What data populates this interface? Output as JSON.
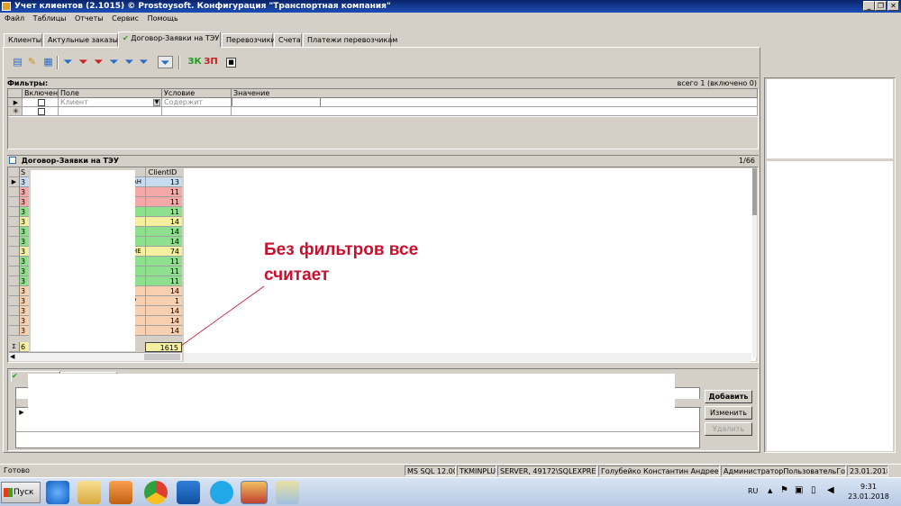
{
  "window": {
    "title": "Учет клиентов (2.1015) © Prostoysoft. Конфигурация \"Транспортная компания\"",
    "minimize": "_",
    "restore": "❐",
    "close": "✕"
  },
  "menu": [
    "Файл",
    "Таблицы",
    "Отчеты",
    "Сервис",
    "Помощь"
  ],
  "tabs": [
    "Клиенты",
    "Актульные заказы",
    "Договор-Заявки на ТЭУ",
    "Перевозчики",
    "Счета",
    "Платежи перевозчикам"
  ],
  "active_tab_check": "✔",
  "toolbar": {
    "zk_label": "ЗК",
    "zp_label": "ЗП"
  },
  "filters": {
    "title": "Фильтры:",
    "summary": "всего 1 (включено 0)",
    "columns": [
      "Включен",
      "Поле",
      "Условие",
      "Значение"
    ],
    "row": {
      "field": "Клиент",
      "condition": "Содержит",
      "value": ""
    },
    "new_row_marker": "✳"
  },
  "grid": {
    "title": "Договор-Заявки на ТЭУ",
    "counter": "1/66",
    "col_first": "S",
    "col_client": "ClientID",
    "rows": [
      {
        "c1": "3",
        "c2": "АН",
        "client": "13",
        "color": "#c8dcf0"
      },
      {
        "c1": "3",
        "c2": "",
        "client": "11",
        "color": "#f4a8a8"
      },
      {
        "c1": "3",
        "c2": "",
        "client": "11",
        "color": "#f4a8a8"
      },
      {
        "c1": "3",
        "c2": "",
        "client": "11",
        "color": "#8ee08e"
      },
      {
        "c1": "3",
        "c2": "",
        "client": "14",
        "color": "#f4f0a0"
      },
      {
        "c1": "3",
        "c2": "",
        "client": "14",
        "color": "#8ee08e"
      },
      {
        "c1": "3",
        "c2": "",
        "client": "14",
        "color": "#8ee08e"
      },
      {
        "c1": "3",
        "c2": "НЕ",
        "client": "74",
        "color": "#f4f0a0"
      },
      {
        "c1": "3",
        "c2": "",
        "client": "11",
        "color": "#8ee08e"
      },
      {
        "c1": "3",
        "c2": "",
        "client": "11",
        "color": "#8ee08e"
      },
      {
        "c1": "3",
        "c2": "",
        "client": "11",
        "color": "#8ee08e"
      },
      {
        "c1": "3",
        "c2": "",
        "client": "14",
        "color": "#f8d0b0"
      },
      {
        "c1": "3",
        "c2": "Р",
        "client": "1",
        "color": "#f8d0b0"
      },
      {
        "c1": "3",
        "c2": "",
        "client": "14",
        "color": "#f8d0b0"
      },
      {
        "c1": "3",
        "c2": "",
        "client": "14",
        "color": "#f8d0b0"
      },
      {
        "c1": "3",
        "c2": "",
        "client": "14",
        "color": "#f8d0b0"
      }
    ],
    "sum_marker": "Σ",
    "sum_first": "6",
    "sum_client": "1615"
  },
  "annotation": {
    "line1": "Без фильтров все",
    "line2": "считает",
    "color": "#c8102e"
  },
  "buttons": {
    "add": "Добавить",
    "edit": "Изменить",
    "delete": "Удалить"
  },
  "status": {
    "ready": "Готово",
    "db": "MS SQL 12.00",
    "instance": "TKMINPLUS",
    "server": "SERVER, 49172\\SQLEXPRESS",
    "user": "Голубейко Константин Андреевич",
    "roles": "АдминистраторПользовательГость",
    "date": "23.01.2018"
  },
  "taskbar": {
    "start": "Пуск",
    "lang": "RU",
    "time": "9:31",
    "date": "23.01.2018"
  }
}
